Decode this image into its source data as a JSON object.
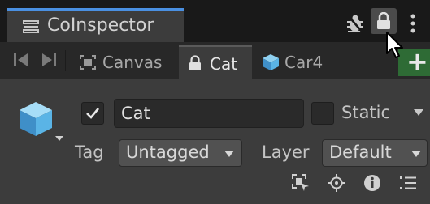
{
  "window": {
    "title": "CoInspector",
    "title_icon": "list-icon",
    "top_icons": [
      "bug-icon",
      "lock-icon",
      "kebab-menu-icon"
    ]
  },
  "tabs": {
    "nav": [
      "first-page-icon",
      "last-page-icon"
    ],
    "items": [
      {
        "label": "Canvas",
        "icon": "canvas-icon",
        "active": false
      },
      {
        "label": "Cat",
        "icon": "lock-icon",
        "active": true
      },
      {
        "label": "Car4",
        "icon": "cube-icon",
        "active": false
      }
    ],
    "add_label": "+"
  },
  "object": {
    "name": "Cat",
    "active": true,
    "static_label": "Static",
    "static": false,
    "tag_label": "Tag",
    "tag_value": "Untagged",
    "layer_label": "Layer",
    "layer_value": "Default"
  },
  "toolbar_icons": [
    "select-frame-icon",
    "crosshair-icon",
    "info-icon",
    "list-detail-icon"
  ],
  "colors": {
    "accent": "#4a90e2",
    "background": "#383838",
    "titlebar": "#191919",
    "add_button": "#2e6b35",
    "cube": "#5ab4e6"
  }
}
